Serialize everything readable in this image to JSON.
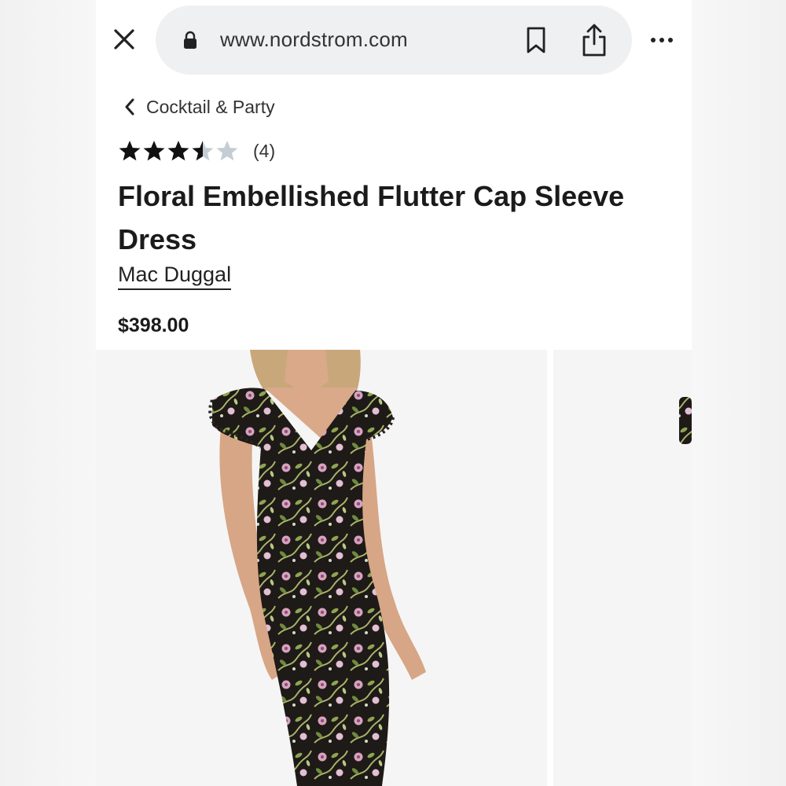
{
  "browser": {
    "url": "www.nordstrom.com"
  },
  "breadcrumb": {
    "label": "Cocktail & Party"
  },
  "rating": {
    "value": 3.5,
    "max": 5,
    "count_label": "(4)"
  },
  "product": {
    "title": "Floral Embellished Flutter Cap Sleeve Dress",
    "brand": "Mac Duggal",
    "price": "$398.00"
  },
  "icons": {
    "close": "close-icon",
    "lock": "lock-icon",
    "bookmark": "bookmark-icon",
    "share": "share-icon",
    "more": "more-icon",
    "back": "chevron-left-icon",
    "star": "star-icon"
  },
  "colors": {
    "star_filled": "#111111",
    "star_empty": "#c3cdd3",
    "urlbar_bg": "#eef0f2",
    "dress_base": "#1e1a17",
    "flower_pink": "#d6a2c0",
    "leaf_green": "#8ea452"
  }
}
